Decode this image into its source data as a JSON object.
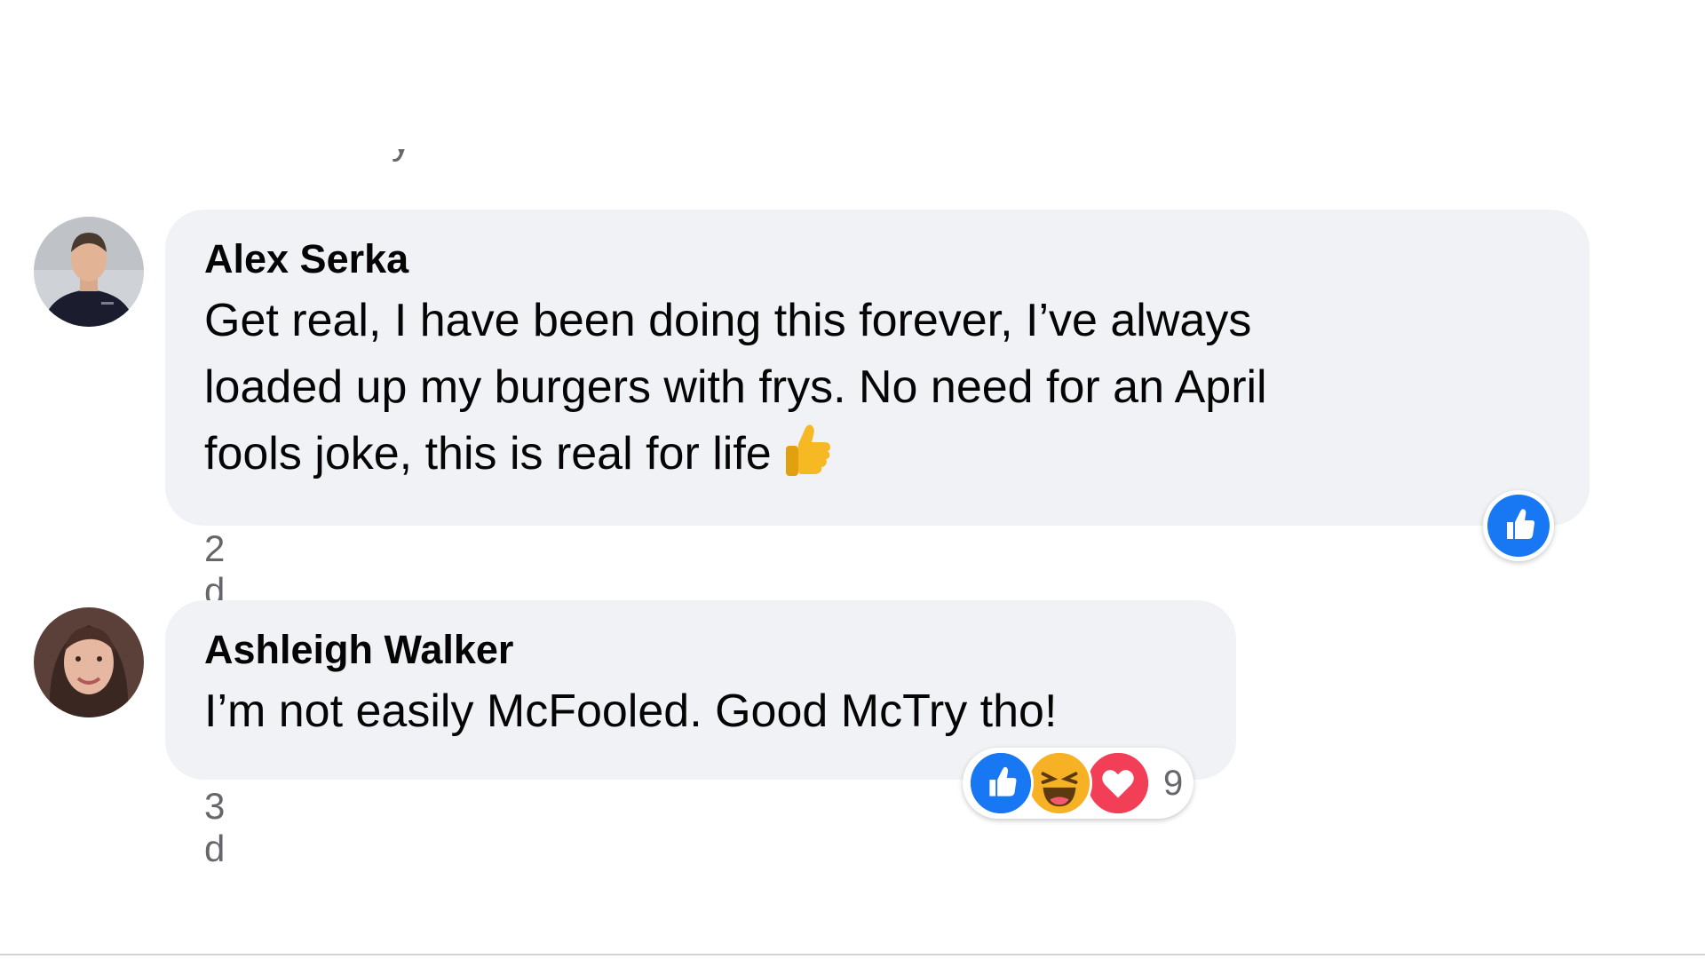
{
  "partial_text": "· y",
  "comments": [
    {
      "author": "Alex Serka",
      "text": "Get real, I have been doing this forever, I’ve always\nloaded up my burgers with frys. No need for an April\nfools joke, this is real for life",
      "inline_emoji": "thumbs-up-emoji",
      "timestamp": "2 d",
      "reactions": [
        "like"
      ],
      "reaction_count": ""
    },
    {
      "author": "Ashleigh Walker",
      "text": "I’m not easily McFooled. Good McTry tho!",
      "timestamp": "3 d",
      "reactions": [
        "like",
        "haha",
        "love"
      ],
      "reaction_count": "9"
    }
  ],
  "colors": {
    "bubble": "#f0f2f5",
    "like_blue": "#1877f2",
    "love_red": "#f33e58",
    "haha_yellow": "#f7b125",
    "secondary_text": "#65676b"
  }
}
